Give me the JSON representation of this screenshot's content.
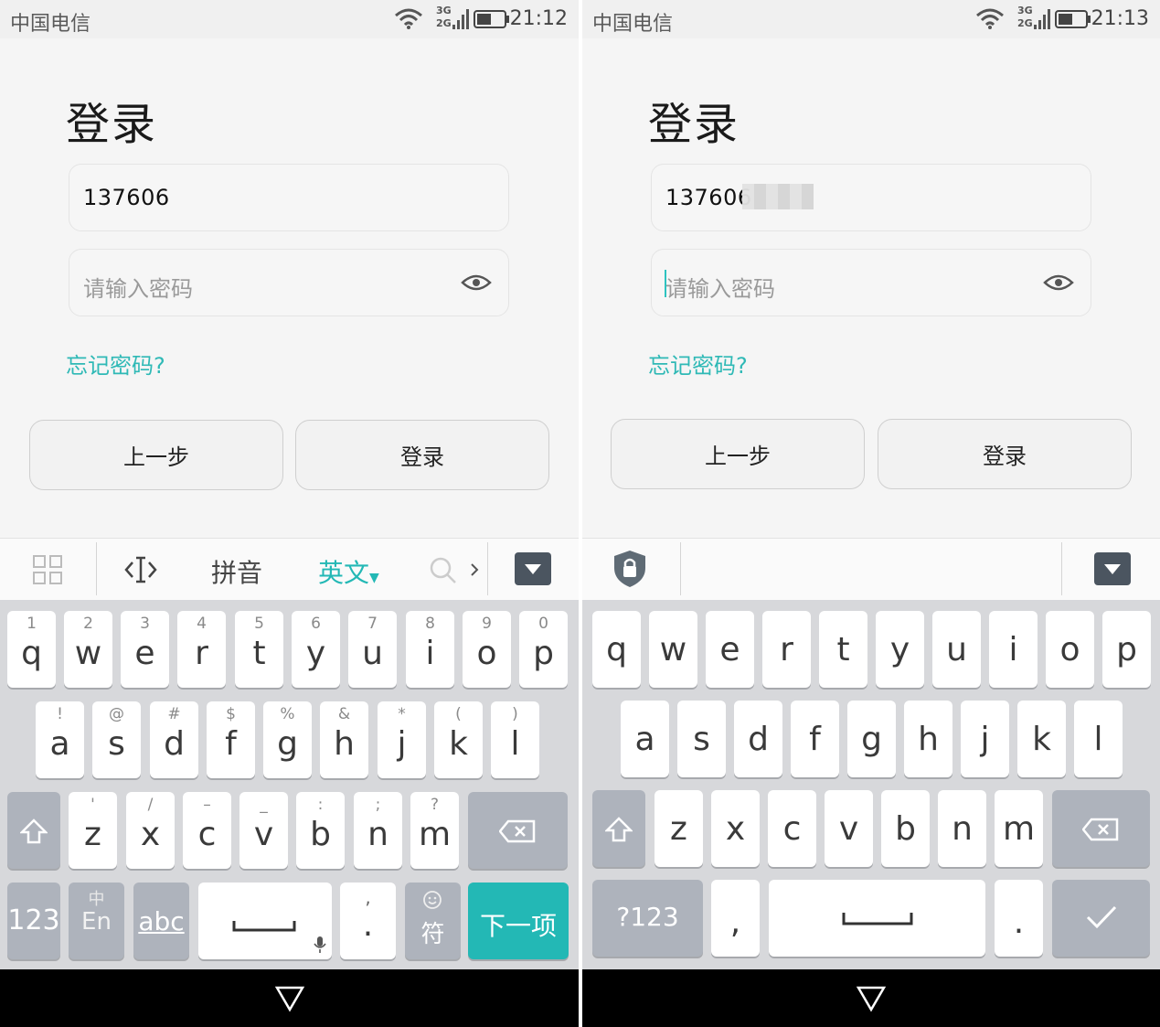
{
  "left": {
    "status": {
      "carrier": "中国电信",
      "time": "21:12",
      "net_top": "3G",
      "net_bottom": "2G"
    },
    "title": "登录",
    "phone_value": "137606",
    "password_placeholder": "请输入密码",
    "forgot": "忘记密码?",
    "prev_button": "上一步",
    "login_button": "登录",
    "candidates": {
      "pinyin": "拼音",
      "english": "英文"
    },
    "row1": [
      {
        "sub": "1",
        "key": "q"
      },
      {
        "sub": "2",
        "key": "w"
      },
      {
        "sub": "3",
        "key": "e"
      },
      {
        "sub": "4",
        "key": "r"
      },
      {
        "sub": "5",
        "key": "t"
      },
      {
        "sub": "6",
        "key": "y"
      },
      {
        "sub": "7",
        "key": "u"
      },
      {
        "sub": "8",
        "key": "i"
      },
      {
        "sub": "9",
        "key": "o"
      },
      {
        "sub": "0",
        "key": "p"
      }
    ],
    "row2": [
      {
        "sub": "!",
        "key": "a"
      },
      {
        "sub": "@",
        "key": "s"
      },
      {
        "sub": "#",
        "key": "d"
      },
      {
        "sub": "$",
        "key": "f"
      },
      {
        "sub": "%",
        "key": "g"
      },
      {
        "sub": "&",
        "key": "h"
      },
      {
        "sub": "*",
        "key": "j"
      },
      {
        "sub": "(",
        "key": "k"
      },
      {
        "sub": ")",
        "key": "l"
      }
    ],
    "row3": [
      {
        "sub": "'",
        "key": "z"
      },
      {
        "sub": "/",
        "key": "x"
      },
      {
        "sub": "–",
        "key": "c"
      },
      {
        "sub": "_",
        "key": "v"
      },
      {
        "sub": ":",
        "key": "b"
      },
      {
        "sub": ";",
        "key": "n"
      },
      {
        "sub": "?",
        "key": "m"
      }
    ],
    "bottom": {
      "num": "123",
      "lang_top": "中",
      "lang_bottom": "En",
      "abc": "abc",
      "comma": ",",
      "period": ".",
      "symbol": "符",
      "next": "下一项"
    }
  },
  "right": {
    "status": {
      "carrier": "中国电信",
      "time": "21:13",
      "net_top": "3G",
      "net_bottom": "2G"
    },
    "title": "登录",
    "phone_value": "137606",
    "password_placeholder": "请输入密码",
    "forgot": "忘记密码?",
    "prev_button": "上一步",
    "login_button": "登录",
    "row1": [
      "q",
      "w",
      "e",
      "r",
      "t",
      "y",
      "u",
      "i",
      "o",
      "p"
    ],
    "row2": [
      "a",
      "s",
      "d",
      "f",
      "g",
      "h",
      "j",
      "k",
      "l"
    ],
    "row3": [
      "z",
      "x",
      "c",
      "v",
      "b",
      "n",
      "m"
    ],
    "bottom": {
      "num": "?123",
      "comma": ",",
      "period": "."
    }
  },
  "colors": {
    "accent": "#23b8b5",
    "link": "#2fb9b6",
    "keyboard_bg": "#d7d8db",
    "function_key": "#aeb3bc"
  },
  "icons": [
    "wifi-icon",
    "signal-icon",
    "battery-icon",
    "eye-icon",
    "grid-icon",
    "cursor-icon",
    "search-icon",
    "chevron-right-icon",
    "keyboard-hide-icon",
    "shift-icon",
    "backspace-icon",
    "mic-icon",
    "emoji-icon",
    "lock-shield-icon",
    "check-icon",
    "nav-back-icon"
  ]
}
